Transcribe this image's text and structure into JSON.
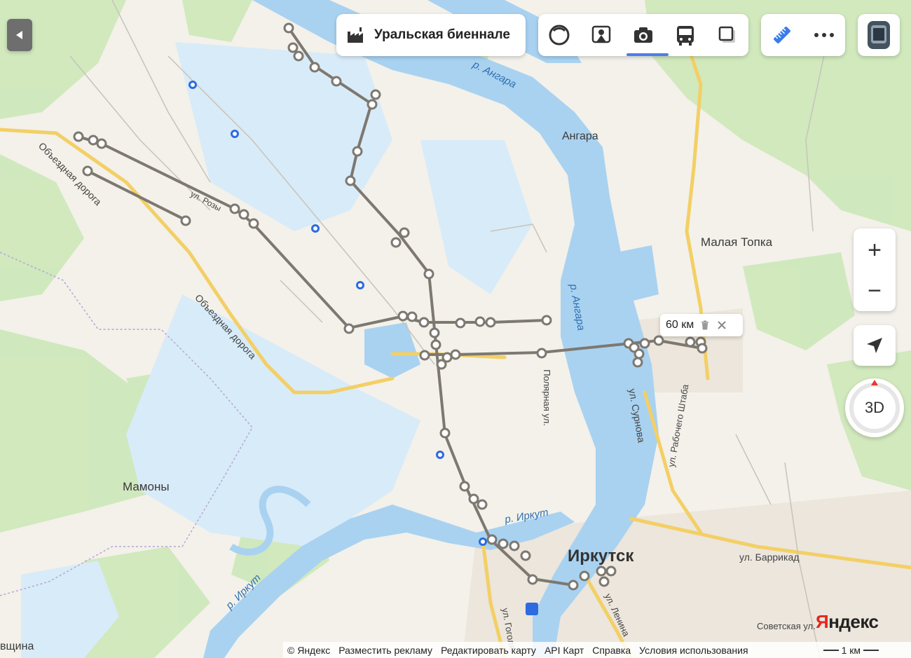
{
  "top_bar": {
    "promo_label": "Уральская биеннале",
    "layers": [
      "panorama-icon",
      "people-icon",
      "camera-icon",
      "bus-icon",
      "layers-icon"
    ],
    "ruler_icon": "ruler-icon",
    "more_icon": "more-icon"
  },
  "map_labels": {
    "angara_river_1": "р. Ангара",
    "angara_river_2": "р. Ангара",
    "angara_place": "Ангара",
    "malaya_topka": "Малая Топка",
    "mamony": "Мамоны",
    "irkutsk": "Иркутск",
    "irkut_river_1": "р. Иркут",
    "irkut_river_2": "р. Иркут",
    "obezdnaya_1": "Объездная дорога",
    "obezdnaya_2": "Объездная дорога",
    "ul_rozy": "ул. Розы",
    "ul_polyarnaya": "Полярная ул.",
    "ul_surnova": "ул. Сурнова",
    "ul_rabochego_shtaba": "ул. Рабочего Штаба",
    "ul_barrikad": "ул. Баррикад",
    "ul_lenina": "ул. Ленина",
    "ul_gogolya": "ул. Гоголя",
    "sovetskaya": "Советская ул.",
    "edge_label": "вщина"
  },
  "ruler": {
    "distance": "60 км",
    "delete_icon": "trash-icon",
    "close_icon": "close-icon"
  },
  "controls": {
    "zoom_in": "+",
    "zoom_out": "−",
    "mode_3d": "3D"
  },
  "brand": "Яндекс",
  "footer": {
    "copyright": "© Яндекс",
    "links": [
      "Разместить рекламу",
      "Редактировать карту",
      "API Карт",
      "Справка",
      "Условия использования"
    ],
    "scale": "1 км"
  },
  "colors": {
    "water": "#a8d0f0",
    "land": "#f2f0ea",
    "forest": "#c9e6b4",
    "major_road": "#f6d77a",
    "route": "#7d7870"
  }
}
